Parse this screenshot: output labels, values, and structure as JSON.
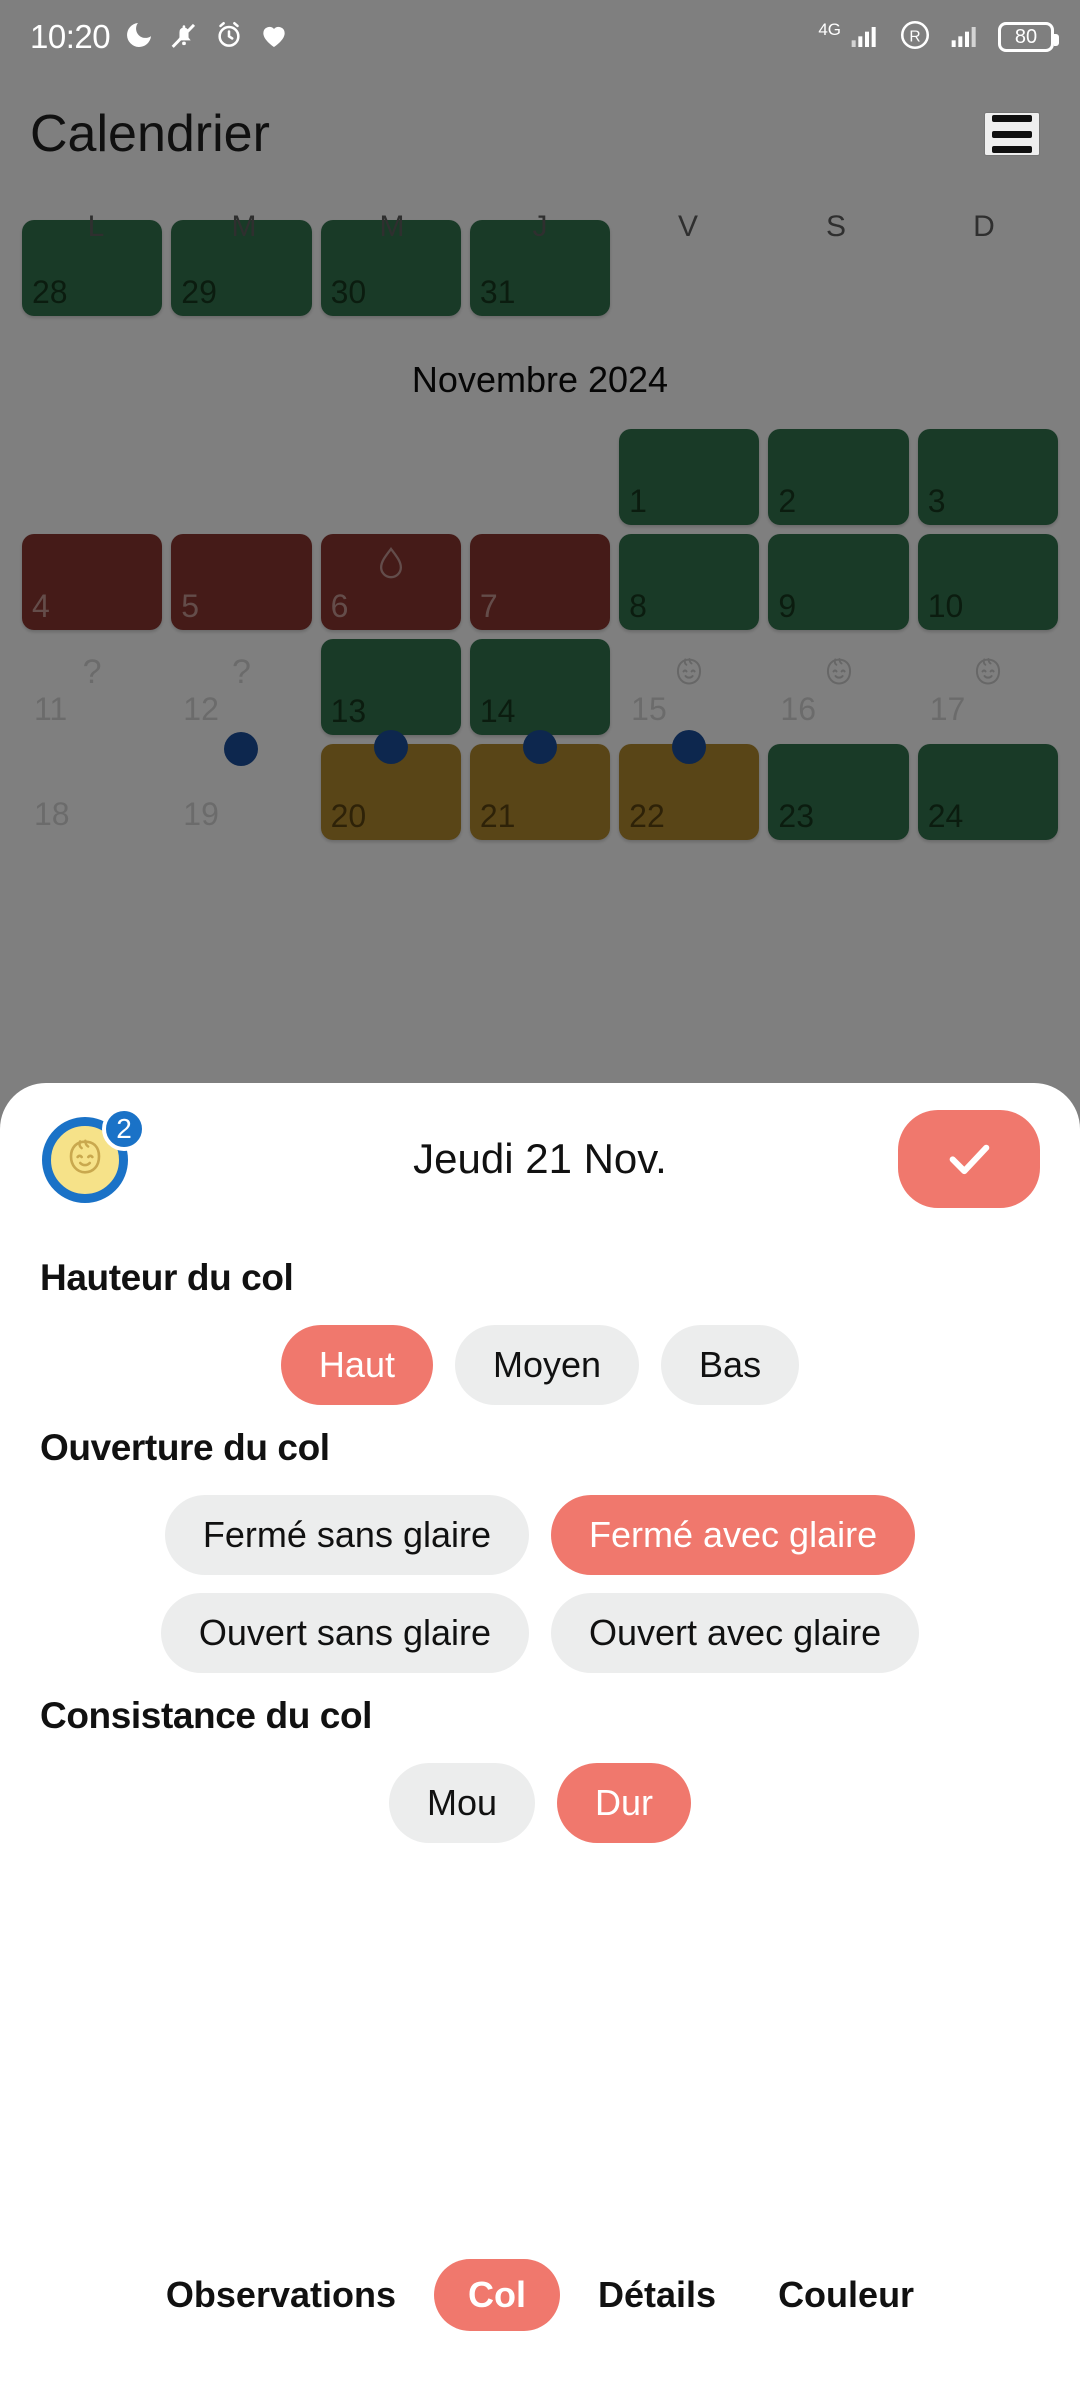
{
  "status_bar": {
    "clock": "10:20",
    "battery_percent": "80",
    "network_type": "4G",
    "roaming_label": "R",
    "left_icons": [
      "do-not-disturb-moon-icon",
      "bell-muted-icon",
      "alarm-clock-icon",
      "heart-icon"
    ],
    "right_icons": [
      "signal-4g-icon",
      "roaming-icon",
      "signal-icon",
      "battery-icon"
    ]
  },
  "header": {
    "title": "Calendrier",
    "menu_icon": "hamburger-menu-icon"
  },
  "weekdays": [
    "L",
    "M",
    "M",
    "J",
    "V",
    "S",
    "D"
  ],
  "calendar": {
    "previous_month_tail": {
      "days": [
        {
          "num": "28",
          "state": "green"
        },
        {
          "num": "29",
          "state": "green"
        },
        {
          "num": "30",
          "state": "green"
        },
        {
          "num": "31",
          "state": "green"
        }
      ]
    },
    "month_label": "Novembre 2024",
    "weeks": [
      [
        {
          "num": "",
          "state": "empty"
        },
        {
          "num": "",
          "state": "empty"
        },
        {
          "num": "",
          "state": "empty"
        },
        {
          "num": "",
          "state": "empty"
        },
        {
          "num": "1",
          "state": "green"
        },
        {
          "num": "2",
          "state": "green"
        },
        {
          "num": "3",
          "state": "green"
        }
      ],
      [
        {
          "num": "4",
          "state": "red"
        },
        {
          "num": "5",
          "state": "red"
        },
        {
          "num": "6",
          "state": "red",
          "mark": "droplet-icon"
        },
        {
          "num": "7",
          "state": "red"
        },
        {
          "num": "8",
          "state": "green"
        },
        {
          "num": "9",
          "state": "green"
        },
        {
          "num": "10",
          "state": "green"
        }
      ],
      [
        {
          "num": "11",
          "state": "plain",
          "mark": "question-mark"
        },
        {
          "num": "12",
          "state": "plain",
          "mark": "question-mark"
        },
        {
          "num": "13",
          "state": "green"
        },
        {
          "num": "14",
          "state": "green"
        },
        {
          "num": "15",
          "state": "plain",
          "mark": "baby-face-icon"
        },
        {
          "num": "16",
          "state": "plain",
          "mark": "baby-face-icon"
        },
        {
          "num": "17",
          "state": "plain",
          "mark": "baby-face-icon"
        }
      ],
      [
        {
          "num": "18",
          "state": "plain"
        },
        {
          "num": "19",
          "state": "plain",
          "badge": true
        },
        {
          "num": "20",
          "state": "tan",
          "badge": true
        },
        {
          "num": "21",
          "state": "tan",
          "badge": true
        },
        {
          "num": "22",
          "state": "tan",
          "badge": true
        },
        {
          "num": "23",
          "state": "green"
        },
        {
          "num": "24",
          "state": "green"
        }
      ]
    ]
  },
  "sheet": {
    "avatar_icon": "baby-face-avatar",
    "avatar_badge": "2",
    "title": "Jeudi 21 Nov.",
    "confirm_icon": "check-icon",
    "accent_color": "#f0786d",
    "chip_bg_color": "#eceded",
    "sections": [
      {
        "title": "Hauteur du col",
        "rows": [
          [
            {
              "label": "Haut",
              "selected": true
            },
            {
              "label": "Moyen",
              "selected": false
            },
            {
              "label": "Bas",
              "selected": false
            }
          ]
        ]
      },
      {
        "title": "Ouverture du col",
        "rows": [
          [
            {
              "label": "Fermé sans glaire",
              "selected": false
            },
            {
              "label": "Fermé avec glaire",
              "selected": true
            }
          ],
          [
            {
              "label": "Ouvert sans glaire",
              "selected": false
            },
            {
              "label": "Ouvert avec glaire",
              "selected": false
            }
          ]
        ]
      },
      {
        "title": "Consistance du col",
        "rows": [
          [
            {
              "label": "Mou",
              "selected": false
            },
            {
              "label": "Dur",
              "selected": true
            }
          ]
        ]
      }
    ],
    "tabs": [
      {
        "label": "Observations",
        "active": false
      },
      {
        "label": "Col",
        "active": true
      },
      {
        "label": "Détails",
        "active": false
      },
      {
        "label": "Couleur",
        "active": false
      }
    ]
  }
}
